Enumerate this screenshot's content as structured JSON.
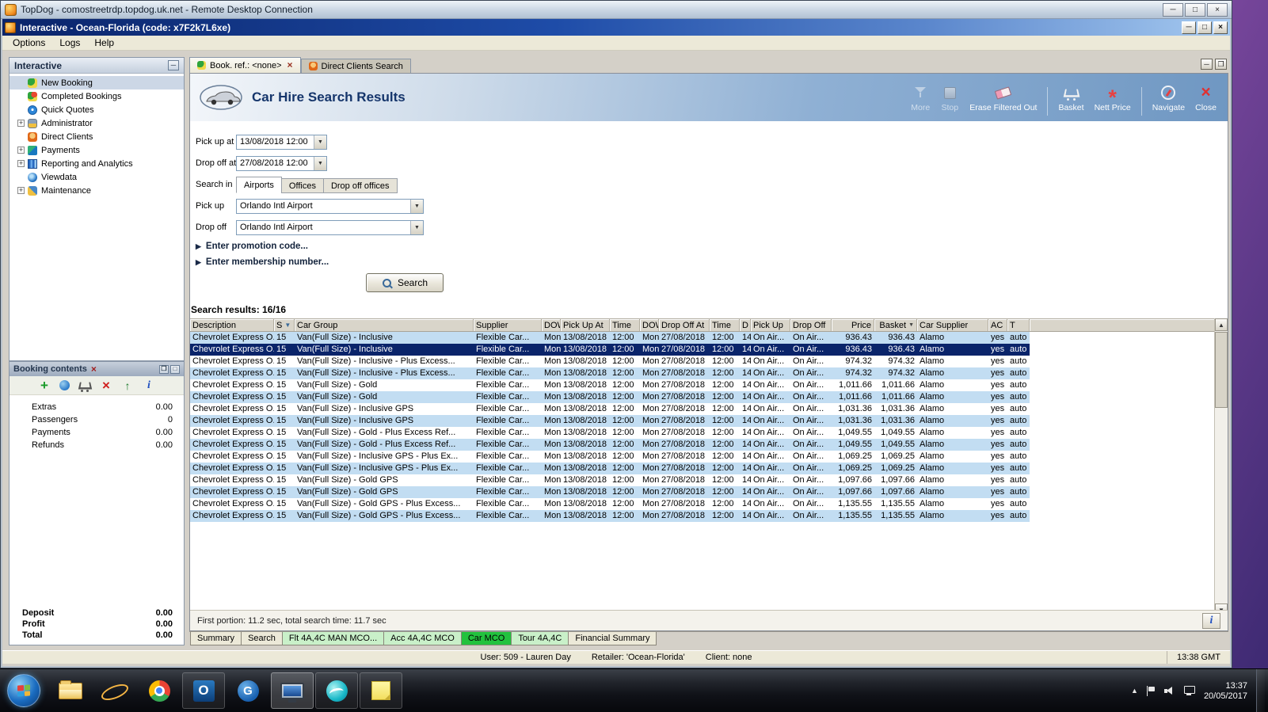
{
  "remote": {
    "title": "TopDog - comostreetrdp.topdog.uk.net - Remote Desktop Connection"
  },
  "window": {
    "title": "Interactive - Ocean-Florida (code: x7F2k7L6xe)",
    "menu": [
      "Options",
      "Logs",
      "Help"
    ]
  },
  "sidebar": {
    "title": "Interactive",
    "items": [
      {
        "label": "New Booking",
        "icon": "palm",
        "expandable": false,
        "selected": true
      },
      {
        "label": "Completed Bookings",
        "icon": "palms",
        "expandable": false
      },
      {
        "label": "Quick Quotes",
        "icon": "clock",
        "expandable": false
      },
      {
        "label": "Administrator",
        "icon": "admin",
        "expandable": true
      },
      {
        "label": "Direct Clients",
        "icon": "clients",
        "expandable": false
      },
      {
        "label": "Payments",
        "icon": "payments",
        "expandable": true
      },
      {
        "label": "Reporting and Analytics",
        "icon": "report",
        "expandable": true
      },
      {
        "label": "Viewdata",
        "icon": "viewdata",
        "expandable": false
      },
      {
        "label": "Maintenance",
        "icon": "maint",
        "expandable": true
      }
    ]
  },
  "booking_contents": {
    "title": "Booking contents",
    "toolbar": [
      {
        "icon": "plus"
      },
      {
        "icon": "globe"
      },
      {
        "icon": "basket"
      },
      {
        "icon": "delete"
      },
      {
        "icon": "upload"
      },
      {
        "icon": "info"
      }
    ],
    "rows": [
      {
        "label": "Extras",
        "value": "0.00"
      },
      {
        "label": "Passengers",
        "value": "0"
      },
      {
        "label": "Payments",
        "value": "0.00"
      },
      {
        "label": "Refunds",
        "value": "0.00"
      }
    ],
    "totals": [
      {
        "label": "Deposit",
        "value": "0.00"
      },
      {
        "label": "Profit",
        "value": "0.00"
      },
      {
        "label": "Total",
        "value": "0.00"
      }
    ]
  },
  "tabs": [
    {
      "label": "Book. ref.: <none>",
      "active": true,
      "closable": true
    },
    {
      "label": "Direct Clients Search",
      "active": false
    }
  ],
  "header": {
    "title": "Car Hire Search Results",
    "toolbar": [
      {
        "label": "More",
        "icon": "more",
        "dim": true
      },
      {
        "label": "Stop",
        "icon": "stop",
        "dim": true
      },
      {
        "label": "Erase Filtered Out",
        "icon": "erase"
      },
      {
        "label": "Basket",
        "icon": "basket",
        "sep": true
      },
      {
        "label": "Nett Price",
        "icon": "nett-price"
      },
      {
        "label": "Navigate",
        "icon": "navigate",
        "sep": true
      },
      {
        "label": "Close",
        "icon": "close"
      }
    ]
  },
  "form": {
    "pickup_at_label": "Pick up at",
    "pickup_at_value": "13/08/2018 12:00",
    "dropoff_at_label": "Drop off at",
    "dropoff_at_value": "27/08/2018 12:00",
    "search_in_label": "Search in",
    "search_in_tabs": [
      "Airports",
      "Offices",
      "Drop off offices"
    ],
    "search_in_active": 0,
    "pickup_label": "Pick up",
    "pickup_value": "Orlando Intl Airport",
    "dropoff_label": "Drop off",
    "dropoff_value": "Orlando Intl Airport",
    "promotion_toggle": "Enter promotion code...",
    "membership_toggle": "Enter membership number...",
    "search_button": "Search"
  },
  "results": {
    "summary": "Search results: 16/16",
    "status": "First portion: 11.2 sec, total search time: 11.7 sec",
    "columns": [
      {
        "label": "Description"
      },
      {
        "label": "S",
        "filter": true
      },
      {
        "label": "Car Group"
      },
      {
        "label": "Supplier"
      },
      {
        "label": "DOW"
      },
      {
        "label": "Pick Up At"
      },
      {
        "label": "Time"
      },
      {
        "label": "DOW"
      },
      {
        "label": "Drop Off At"
      },
      {
        "label": "Time"
      },
      {
        "label": "D"
      },
      {
        "label": "Pick Up"
      },
      {
        "label": "Drop Off"
      },
      {
        "label": "Price",
        "align": "right"
      },
      {
        "label": "Basket",
        "align": "right",
        "sort": true
      },
      {
        "label": "Car Supplier"
      },
      {
        "label": "AC"
      },
      {
        "label": "T"
      }
    ],
    "rows": [
      {
        "shade": "blue",
        "cells": [
          "Chevrolet Express O...",
          "15",
          "Van(Full Size) - Inclusive",
          "Flexible Car...",
          "Mon",
          "13/08/2018",
          "12:00",
          "Mon",
          "27/08/2018",
          "12:00",
          "14",
          "On Air...",
          "On Air...",
          "936.43",
          "936.43",
          "Alamo",
          "yes",
          "auto"
        ]
      },
      {
        "shade": "sel",
        "cells": [
          "Chevrolet Express O...",
          "15",
          "Van(Full Size) - Inclusive",
          "Flexible Car...",
          "Mon",
          "13/08/2018",
          "12:00",
          "Mon",
          "27/08/2018",
          "12:00",
          "14",
          "On Air...",
          "On Air...",
          "936.43",
          "936.43",
          "Alamo",
          "yes",
          "auto"
        ]
      },
      {
        "shade": "white",
        "cells": [
          "Chevrolet Express O...",
          "15",
          "Van(Full Size) - Inclusive - Plus Excess...",
          "Flexible Car...",
          "Mon",
          "13/08/2018",
          "12:00",
          "Mon",
          "27/08/2018",
          "12:00",
          "14",
          "On Air...",
          "On Air...",
          "974.32",
          "974.32",
          "Alamo",
          "yes",
          "auto"
        ]
      },
      {
        "shade": "blue",
        "cells": [
          "Chevrolet Express O...",
          "15",
          "Van(Full Size) - Inclusive - Plus Excess...",
          "Flexible Car...",
          "Mon",
          "13/08/2018",
          "12:00",
          "Mon",
          "27/08/2018",
          "12:00",
          "14",
          "On Air...",
          "On Air...",
          "974.32",
          "974.32",
          "Alamo",
          "yes",
          "auto"
        ]
      },
      {
        "shade": "white",
        "cells": [
          "Chevrolet Express O...",
          "15",
          "Van(Full Size) - Gold",
          "Flexible Car...",
          "Mon",
          "13/08/2018",
          "12:00",
          "Mon",
          "27/08/2018",
          "12:00",
          "14",
          "On Air...",
          "On Air...",
          "1,011.66",
          "1,011.66",
          "Alamo",
          "yes",
          "auto"
        ]
      },
      {
        "shade": "blue",
        "cells": [
          "Chevrolet Express O...",
          "15",
          "Van(Full Size) - Gold",
          "Flexible Car...",
          "Mon",
          "13/08/2018",
          "12:00",
          "Mon",
          "27/08/2018",
          "12:00",
          "14",
          "On Air...",
          "On Air...",
          "1,011.66",
          "1,011.66",
          "Alamo",
          "yes",
          "auto"
        ]
      },
      {
        "shade": "white",
        "cells": [
          "Chevrolet Express O...",
          "15",
          "Van(Full Size) - Inclusive GPS",
          "Flexible Car...",
          "Mon",
          "13/08/2018",
          "12:00",
          "Mon",
          "27/08/2018",
          "12:00",
          "14",
          "On Air...",
          "On Air...",
          "1,031.36",
          "1,031.36",
          "Alamo",
          "yes",
          "auto"
        ]
      },
      {
        "shade": "blue",
        "cells": [
          "Chevrolet Express O...",
          "15",
          "Van(Full Size) - Inclusive GPS",
          "Flexible Car...",
          "Mon",
          "13/08/2018",
          "12:00",
          "Mon",
          "27/08/2018",
          "12:00",
          "14",
          "On Air...",
          "On Air...",
          "1,031.36",
          "1,031.36",
          "Alamo",
          "yes",
          "auto"
        ]
      },
      {
        "shade": "white",
        "cells": [
          "Chevrolet Express O...",
          "15",
          "Van(Full Size) - Gold - Plus Excess Ref...",
          "Flexible Car...",
          "Mon",
          "13/08/2018",
          "12:00",
          "Mon",
          "27/08/2018",
          "12:00",
          "14",
          "On Air...",
          "On Air...",
          "1,049.55",
          "1,049.55",
          "Alamo",
          "yes",
          "auto"
        ]
      },
      {
        "shade": "blue",
        "cells": [
          "Chevrolet Express O...",
          "15",
          "Van(Full Size) - Gold - Plus Excess Ref...",
          "Flexible Car...",
          "Mon",
          "13/08/2018",
          "12:00",
          "Mon",
          "27/08/2018",
          "12:00",
          "14",
          "On Air...",
          "On Air...",
          "1,049.55",
          "1,049.55",
          "Alamo",
          "yes",
          "auto"
        ]
      },
      {
        "shade": "white",
        "cells": [
          "Chevrolet Express O...",
          "15",
          "Van(Full Size) - Inclusive GPS - Plus Ex...",
          "Flexible Car...",
          "Mon",
          "13/08/2018",
          "12:00",
          "Mon",
          "27/08/2018",
          "12:00",
          "14",
          "On Air...",
          "On Air...",
          "1,069.25",
          "1,069.25",
          "Alamo",
          "yes",
          "auto"
        ]
      },
      {
        "shade": "blue",
        "cells": [
          "Chevrolet Express O...",
          "15",
          "Van(Full Size) - Inclusive GPS - Plus Ex...",
          "Flexible Car...",
          "Mon",
          "13/08/2018",
          "12:00",
          "Mon",
          "27/08/2018",
          "12:00",
          "14",
          "On Air...",
          "On Air...",
          "1,069.25",
          "1,069.25",
          "Alamo",
          "yes",
          "auto"
        ]
      },
      {
        "shade": "white",
        "cells": [
          "Chevrolet Express O...",
          "15",
          "Van(Full Size) - Gold GPS",
          "Flexible Car...",
          "Mon",
          "13/08/2018",
          "12:00",
          "Mon",
          "27/08/2018",
          "12:00",
          "14",
          "On Air...",
          "On Air...",
          "1,097.66",
          "1,097.66",
          "Alamo",
          "yes",
          "auto"
        ]
      },
      {
        "shade": "blue",
        "cells": [
          "Chevrolet Express O...",
          "15",
          "Van(Full Size) - Gold GPS",
          "Flexible Car...",
          "Mon",
          "13/08/2018",
          "12:00",
          "Mon",
          "27/08/2018",
          "12:00",
          "14",
          "On Air...",
          "On Air...",
          "1,097.66",
          "1,097.66",
          "Alamo",
          "yes",
          "auto"
        ]
      },
      {
        "shade": "white",
        "cells": [
          "Chevrolet Express O...",
          "15",
          "Van(Full Size) - Gold GPS - Plus Excess...",
          "Flexible Car...",
          "Mon",
          "13/08/2018",
          "12:00",
          "Mon",
          "27/08/2018",
          "12:00",
          "14",
          "On Air...",
          "On Air...",
          "1,135.55",
          "1,135.55",
          "Alamo",
          "yes",
          "auto"
        ]
      },
      {
        "shade": "blue",
        "cells": [
          "Chevrolet Express O...",
          "15",
          "Van(Full Size) - Gold GPS - Plus Excess...",
          "Flexible Car...",
          "Mon",
          "13/08/2018",
          "12:00",
          "Mon",
          "27/08/2018",
          "12:00",
          "14",
          "On Air...",
          "On Air...",
          "1,135.55",
          "1,135.55",
          "Alamo",
          "yes",
          "auto"
        ]
      }
    ]
  },
  "bottom_tabs": [
    {
      "label": "Summary",
      "style": "plain"
    },
    {
      "label": "Search",
      "style": "plain"
    },
    {
      "label": "Flt 4A,4C MAN MCO...",
      "style": "pale"
    },
    {
      "label": "Acc 4A,4C MCO",
      "style": "pale"
    },
    {
      "label": "Car MCO",
      "style": "active"
    },
    {
      "label": "Tour 4A,4C",
      "style": "pale"
    },
    {
      "label": "Financial Summary",
      "style": "plain"
    }
  ],
  "status_bar": {
    "user": "User: 509 - Lauren Day",
    "retailer": "Retailer: 'Ocean-Florida'",
    "client": "Client: none",
    "time": "13:38 GMT"
  },
  "taskbar": {
    "items": [
      {
        "icon": "explorer"
      },
      {
        "icon": "internet-explorer"
      },
      {
        "icon": "chrome"
      },
      {
        "icon": "outlook",
        "running": true
      },
      {
        "icon": "g-app"
      },
      {
        "icon": "remote-desktop",
        "running": true,
        "active": true
      },
      {
        "icon": "teal-app",
        "running": true
      },
      {
        "icon": "sticky-notes",
        "running": true
      }
    ],
    "time": "13:37",
    "date": "20/05/2017"
  },
  "colors": {
    "selected_row": "#0a246a",
    "row_stripe_blue": "#c2ddf2",
    "active_tab_green": "#22c23e",
    "pale_tab_green": "#c9f0c9",
    "titlebar_blue": "#0a246a"
  }
}
